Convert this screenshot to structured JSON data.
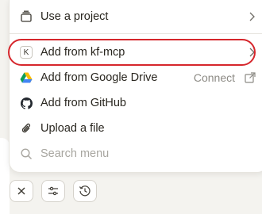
{
  "menu": {
    "items": [
      {
        "label": "Use a project",
        "icon": "project-stack-icon",
        "has_submenu": true
      },
      {
        "label": "Add from kf-mcp",
        "icon": "kf-mcp-badge-icon",
        "badge": "K",
        "has_submenu": true,
        "highlighted": true
      },
      {
        "label": "Add from Google Drive",
        "icon": "google-drive-icon",
        "action": "Connect"
      },
      {
        "label": "Add from GitHub",
        "icon": "github-icon"
      },
      {
        "label": "Upload a file",
        "icon": "paperclip-icon"
      }
    ],
    "search": {
      "placeholder": "Search menu",
      "icon": "search-icon"
    }
  },
  "toolbar": {
    "buttons": [
      {
        "icon": "close-icon"
      },
      {
        "icon": "sliders-icon"
      },
      {
        "icon": "history-clock-icon"
      }
    ]
  },
  "colors": {
    "highlight_ring": "#d6262c",
    "background": "#f4f3ef",
    "menu_background": "#ffffff",
    "muted_text": "#8c8a84"
  }
}
